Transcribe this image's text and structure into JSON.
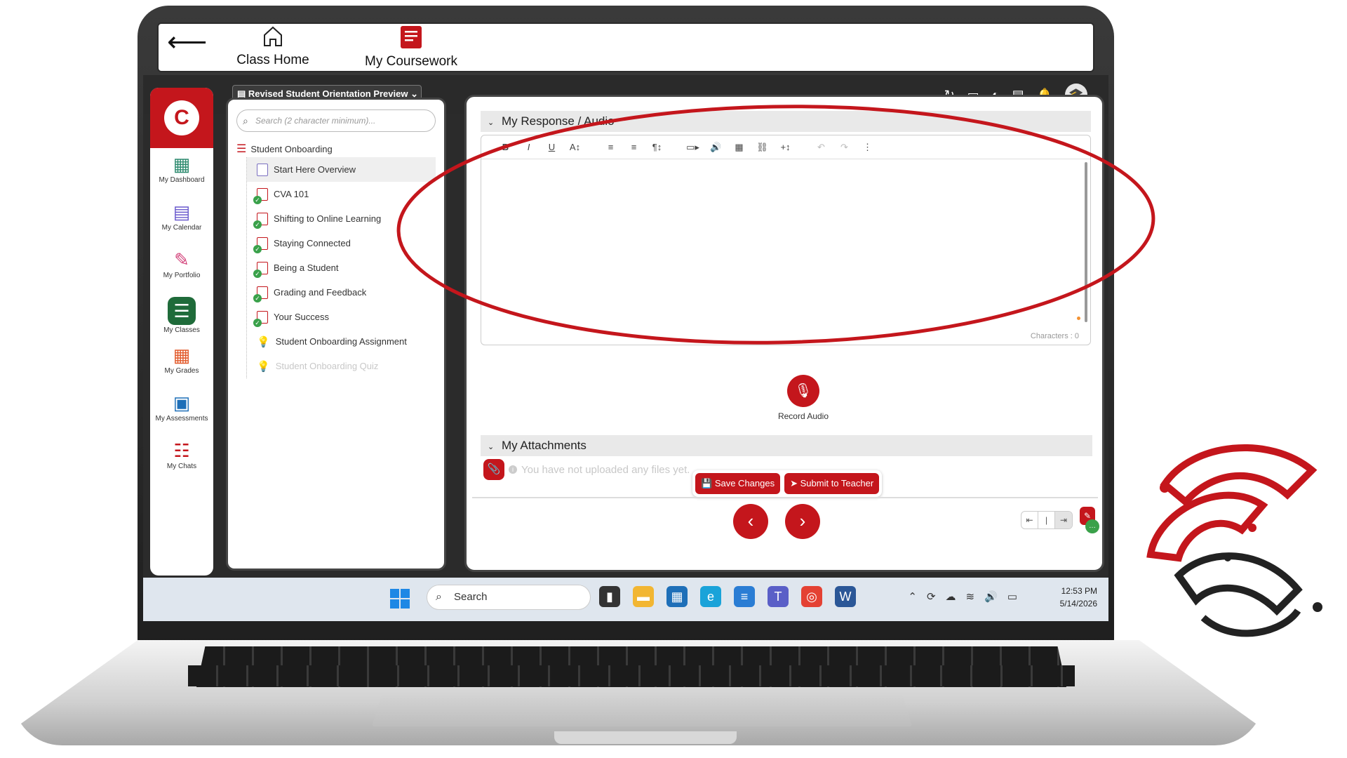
{
  "topnav": {
    "back_icon": "arrow-left-icon",
    "tabs": [
      {
        "label": "Class Home",
        "icon": "home-icon"
      },
      {
        "label": "My Coursework",
        "icon": "coursework-icon"
      }
    ]
  },
  "header": {
    "course_select": "Revised Student Orientation Preview",
    "icons": [
      "refresh-icon",
      "window-icon",
      "contrast-icon",
      "notes-icon",
      "bell-icon",
      "avatar-graduate-icon"
    ]
  },
  "sidebar": {
    "items": [
      {
        "label": "My Dashboard",
        "glyph": "▦"
      },
      {
        "label": "My Calendar",
        "glyph": "▤"
      },
      {
        "label": "My Portfolio",
        "glyph": "✎"
      },
      {
        "label": "My Classes",
        "glyph": "☰"
      },
      {
        "label": "My Grades",
        "glyph": "▦"
      },
      {
        "label": "My Assessments",
        "glyph": "📋"
      },
      {
        "label": "My Chats",
        "glyph": "☷"
      }
    ],
    "active": "My Classes"
  },
  "tree": {
    "search_placeholder": "Search (2 character minimum)...",
    "root": "Student Onboarding",
    "items": [
      {
        "label": "Start Here Overview"
      },
      {
        "label": "CVA 101"
      },
      {
        "label": "Shifting to Online Learning"
      },
      {
        "label": "Staying Connected"
      },
      {
        "label": "Being a Student"
      },
      {
        "label": "Grading and Feedback"
      },
      {
        "label": "Your Success"
      },
      {
        "label": "Student Onboarding Assignment"
      },
      {
        "label": "Student Onboarding Quiz"
      }
    ]
  },
  "response": {
    "section_title": "My Response / Audio",
    "toolbar": [
      "B",
      "I",
      "U",
      "A↕",
      "≡",
      "≡",
      "¶↕",
      "▭▸",
      "🔊",
      "▦",
      "⛓",
      "+↕",
      "↶",
      "↷",
      "⋮"
    ],
    "characters_label": "Characters : 0",
    "record_label": "Record Audio"
  },
  "attachments": {
    "section_title": "My Attachments",
    "empty_text": "You have not uploaded any files yet."
  },
  "actions": {
    "save": "Save Changes",
    "submit": "Submit to Teacher"
  },
  "taskbar": {
    "search_label": "Search",
    "time": "12:53 PM",
    "date": "5/14/2026"
  },
  "colors": {
    "brand_red": "#c4161c",
    "active_green": "#1f6b3a",
    "check_green": "#3aa14a"
  }
}
